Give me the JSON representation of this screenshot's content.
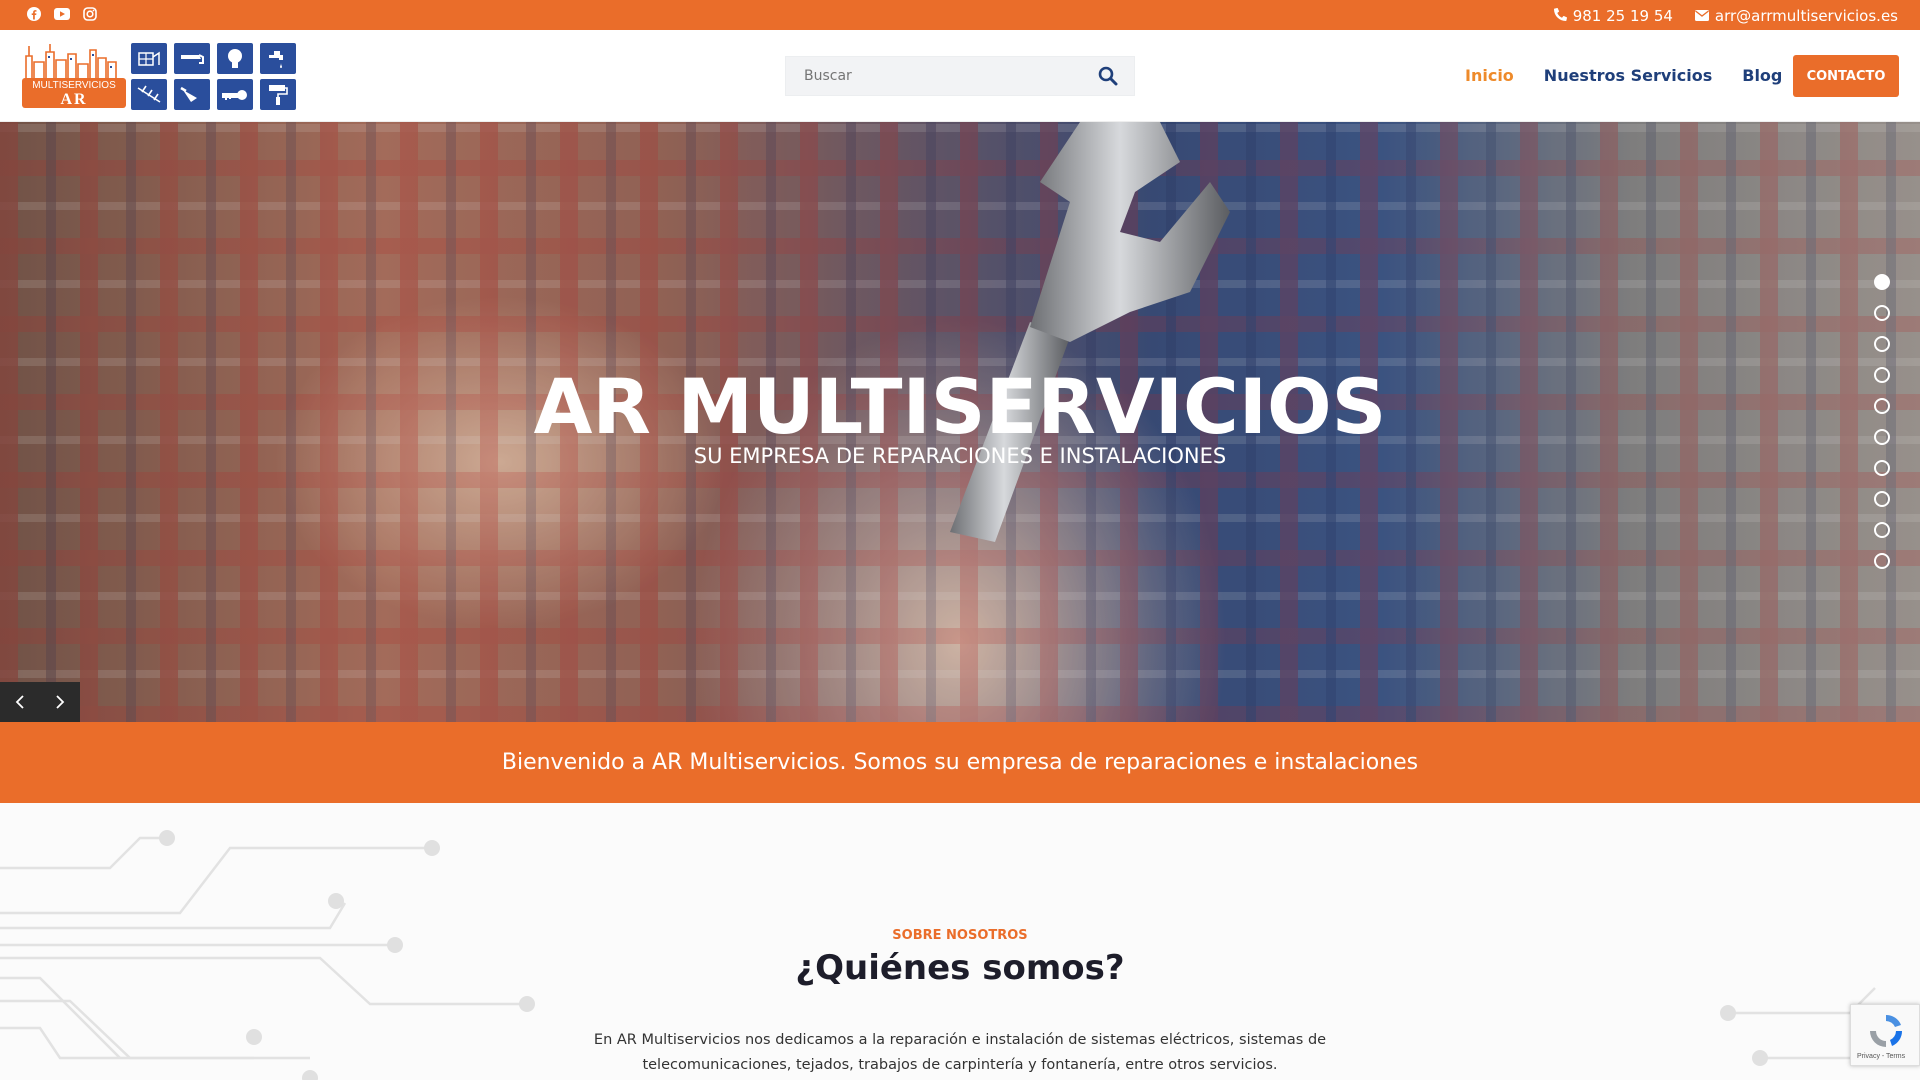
{
  "topbar": {
    "social_icons": [
      "facebook-icon",
      "youtube-icon",
      "instagram-icon"
    ],
    "phone": "981 25 19 54",
    "email": "arr@arrmultiservicios.es"
  },
  "logo": {
    "line1": "MULTISERVICIOS",
    "line2": "AR"
  },
  "search": {
    "placeholder": "Buscar"
  },
  "nav": {
    "items": [
      "Inicio",
      "Nuestros Servicios",
      "Blog"
    ],
    "active": "Inicio",
    "cta": "CONTACTO"
  },
  "hero": {
    "title": "AR MULTISERVICIOS",
    "subtitle": "SU EMPRESA DE REPARACIONES E INSTALACIONES",
    "slide_count": 10,
    "active_slide": 1
  },
  "band": {
    "text": "Bienvenido a AR Multiservicios. Somos su empresa de reparaciones e instalaciones"
  },
  "about": {
    "kicker": "SOBRE NOSOTROS",
    "title": "¿Quiénes somos?",
    "text": "En AR Multiservicios nos dedicamos a la reparación e instalación de sistemas eléctricos, sistemas de telecomunicaciones, tejados, trabajos de carpintería y fontanería, entre otros servicios."
  },
  "recaptcha": {
    "text": "Privacy - Terms"
  },
  "colors": {
    "accent": "#ea6d2a",
    "nav": "#1f3f7a",
    "active_nav": "#ee8a2a"
  }
}
